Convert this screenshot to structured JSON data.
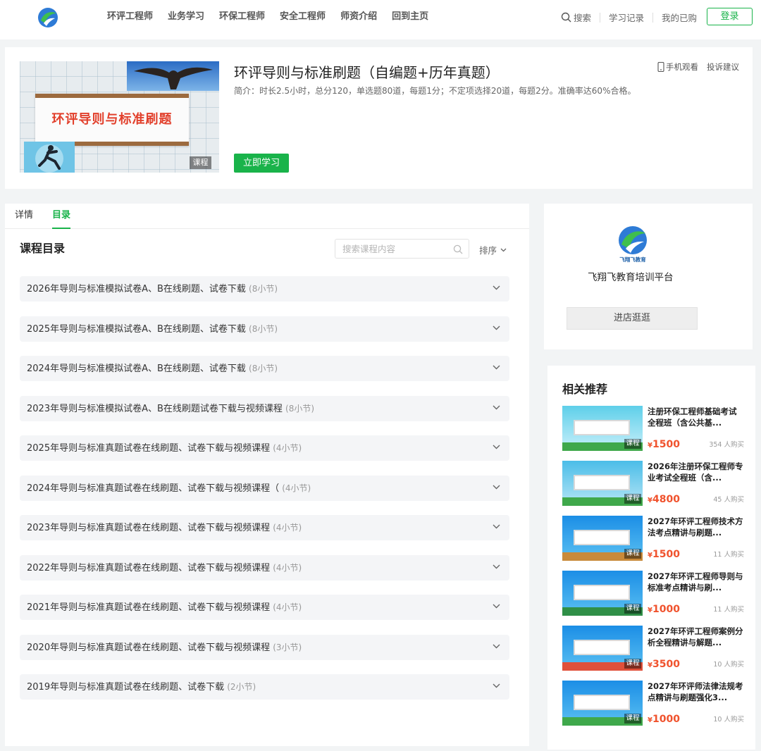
{
  "nav": {
    "items": [
      "环评工程师",
      "业务学习",
      "环保工程师",
      "安全工程师",
      "师资介绍",
      "回到主页"
    ],
    "search_label": "搜索",
    "history_label": "学习记录",
    "purchased_label": "我的已购",
    "login_label": "登录"
  },
  "course": {
    "cover_text": "环评导则与标准刷题",
    "cover_badge": "课程",
    "title": "环评导则与标准刷题（自编题+历年真题）",
    "description": "简介：时长2.5小时，总分120，单选题80道，每题1分；不定项选择20道，每题2分。准确率达60%合格。",
    "mobile_label": "手机观看",
    "feedback_label": "投诉建议",
    "study_label": "立即学习"
  },
  "tabs": [
    "详情",
    "目录"
  ],
  "catalog": {
    "title": "课程目录",
    "search_placeholder": "搜索课程内容",
    "sort_label": "排序",
    "chapters": [
      {
        "title": "2026年导则与标准模拟试卷A、B在线刷题、试卷下载",
        "count": "(8小节)"
      },
      {
        "title": "2025年导则与标准模拟试卷A、B在线刷题、试卷下载",
        "count": "(8小节)"
      },
      {
        "title": "2024年导则与标准模拟试卷A、B在线刷题、试卷下载",
        "count": "(8小节)"
      },
      {
        "title": "2023年导则与标准模拟试卷A、B在线刷题试卷下载与视频课程",
        "count": "(8小节)"
      },
      {
        "title": "2025年导则与标准真题试卷在线刷题、试卷下载与视频课程",
        "count": "(4小节)"
      },
      {
        "title": "2024年导则与标准真题试卷在线刷题、试卷下载与视频课程（",
        "count": "(4小节)"
      },
      {
        "title": "2023年导则与标准真题试卷在线刷题、试卷下载与视频课程",
        "count": "(4小节)"
      },
      {
        "title": "2022年导则与标准真题试卷在线刷题、试卷下载与视频课程",
        "count": "(4小节)"
      },
      {
        "title": "2021年导则与标准真题试卷在线刷题、试卷下载与视频课程",
        "count": "(4小节)"
      },
      {
        "title": "2020年导则与标准真题试卷在线刷题、试卷下载与视频课程",
        "count": "(3小节)"
      },
      {
        "title": "2019年导则与标准真题试卷在线刷题、试卷下载",
        "count": "(2小节)"
      }
    ]
  },
  "shop": {
    "logo_text": "飞翔飞教育",
    "name": "飞翔飞教育培训平台",
    "enter_label": "进店逛逛"
  },
  "recommend": {
    "title": "相关推荐",
    "items": [
      {
        "title": "注册环保工程师基础考试全程班（含公共基...",
        "price": "1500",
        "sold": "354 人购买",
        "tag": "课程"
      },
      {
        "title": "2026年注册环保工程师专业考试全程班（含...",
        "price": "4800",
        "sold": "45 人购买",
        "tag": "课程"
      },
      {
        "title": "2027年环评工程师技术方法考点精讲与刷题...",
        "price": "1500",
        "sold": "11 人购买",
        "tag": "课程"
      },
      {
        "title": "2027年环评工程师导则与标准考点精讲与刷...",
        "price": "1000",
        "sold": "11 人购买",
        "tag": "课程"
      },
      {
        "title": "2027年环评工程师案例分析全程精讲与解题...",
        "price": "3500",
        "sold": "10 人购买",
        "tag": "课程"
      },
      {
        "title": "2027年环评师法律法规考点精讲与刷题强化3...",
        "price": "1000",
        "sold": "10 人购买",
        "tag": "课程"
      }
    ],
    "currency": "¥"
  },
  "colors": {
    "brand_green": "#19b34a",
    "price_red": "#f0522d"
  }
}
